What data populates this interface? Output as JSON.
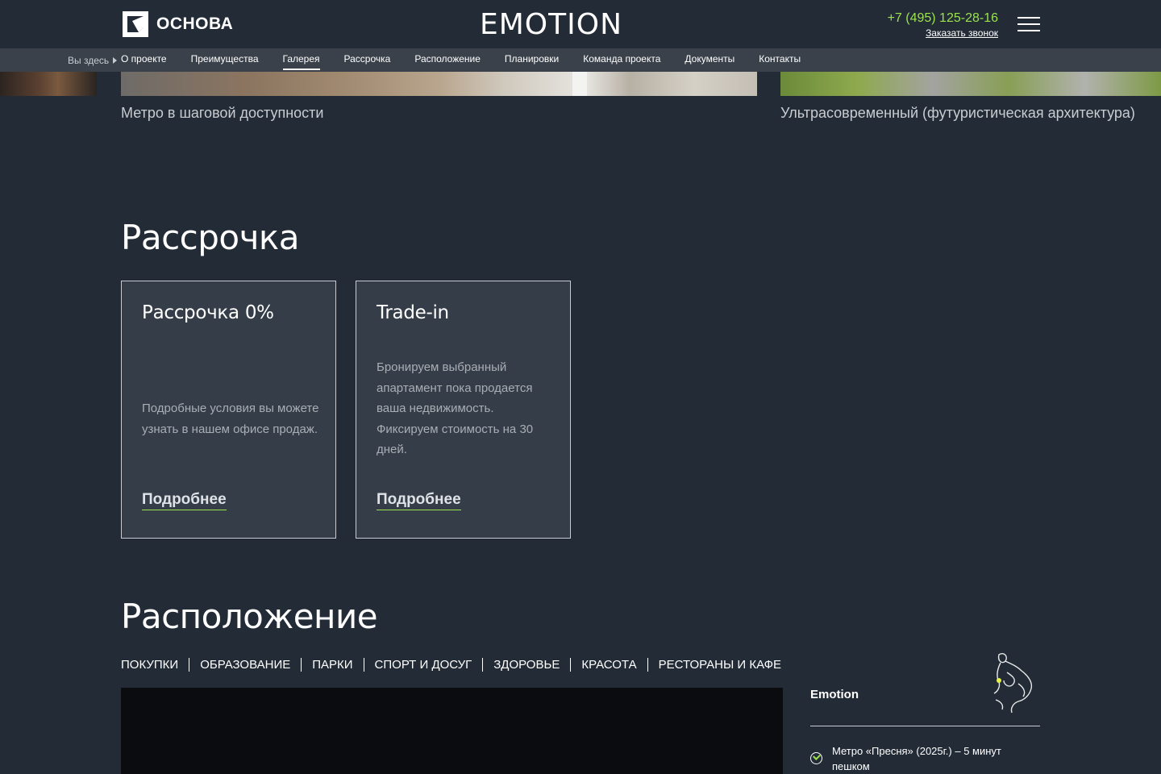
{
  "header": {
    "logo_text": "ОСНОВА",
    "brand": "EMOTION",
    "phone": "+7 (495) 125-28-16",
    "callback": "Заказать звонок"
  },
  "breadcrumb": {
    "label": "Вы здесь"
  },
  "nav": {
    "items": [
      "О проекте",
      "Преимущества",
      "Галерея",
      "Рассрочка",
      "Расположение",
      "Планировки",
      "Команда проекта",
      "Документы",
      "Контакты"
    ],
    "active": "Галерея"
  },
  "gallery": {
    "caption_left": "Метро в шаговой доступности",
    "caption_right": "Ультрасовременный (футуристическая архитектура)"
  },
  "installment": {
    "title": "Рассрочка",
    "cards": [
      {
        "title": "Рассрочка 0%",
        "text": "Подробные условия вы можете узнать в нашем офисе продаж.",
        "link": "Подробнее"
      },
      {
        "title": "Trade-in",
        "text": "Бронируем выбранный апартамент пока продается ваша недвижимость. Фиксируем стоимость на 30 дней.",
        "link": "Подробнее"
      }
    ]
  },
  "location": {
    "title": "Расположение",
    "categories": [
      "ПОКУПКИ",
      "ОБРАЗОВАНИЕ",
      "ПАРКИ",
      "СПОРТ И ДОСУГ",
      "ЗДОРОВЬЕ",
      "КРАСОТА",
      "РЕСТОРАНЫ И КАФЕ"
    ],
    "panel_title": "Emotion",
    "panel_item": "Метро «Пресня» (2025г.) – 5 минут пешком"
  },
  "colors": {
    "background": "#222b36",
    "accent": "#9be34c",
    "card": "#353d48",
    "navbar": "#3a414b"
  }
}
